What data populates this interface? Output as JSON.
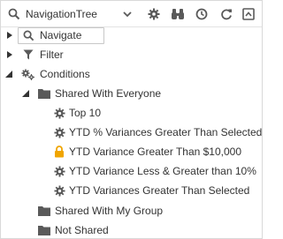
{
  "toolbar": {
    "title": "NavigationTree",
    "icons": [
      "search-icon",
      "chevron-down-icon",
      "gear-icon",
      "binoculars-icon",
      "clock-icon",
      "refresh-icon",
      "collapse-icon"
    ]
  },
  "tree": {
    "navigate": {
      "label": "Navigate",
      "icon": "search-icon"
    },
    "filter": {
      "label": "Filter",
      "icon": "filter-icon"
    },
    "conditions": {
      "label": "Conditions",
      "icon": "gears-icon",
      "shared_everyone": {
        "label": "Shared With Everyone",
        "icon": "folder-icon",
        "items": [
          {
            "label": "Top 10",
            "icon": "gear-icon"
          },
          {
            "label": "YTD % Variances Greater Than Selected",
            "icon": "gear-icon"
          },
          {
            "label": "YTD Variance Greater Than $10,000",
            "icon": "lock-icon"
          },
          {
            "label": "YTD Variance Less & Greater than 10%",
            "icon": "gear-icon"
          },
          {
            "label": "YTD Variances Greater Than Selected",
            "icon": "gear-icon"
          }
        ]
      },
      "shared_group": {
        "label": "Shared With My Group",
        "icon": "folder-icon"
      },
      "not_shared": {
        "label": "Not Shared",
        "icon": "folder-icon"
      }
    }
  },
  "colors": {
    "icon": "#5a5a5a",
    "lock": "#f0a500",
    "border": "#d9d9d9"
  }
}
